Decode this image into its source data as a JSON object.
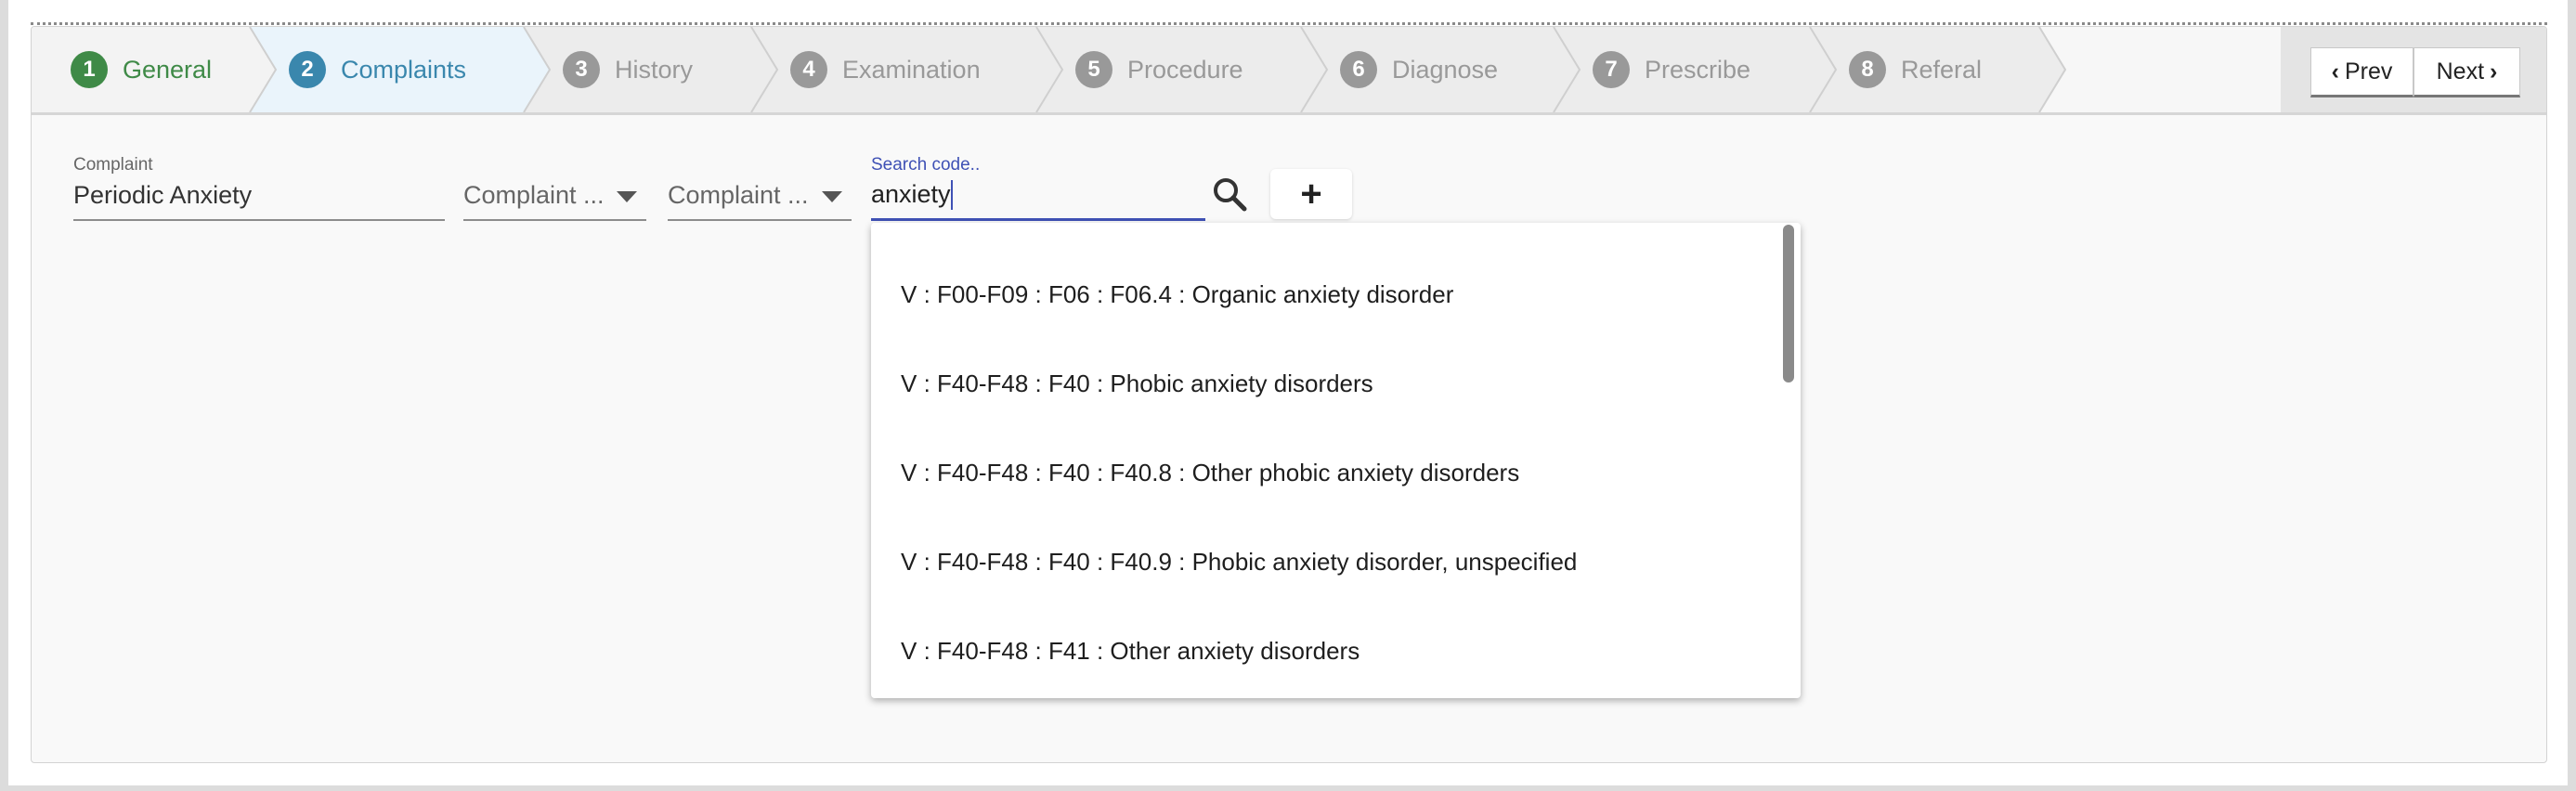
{
  "wizard": {
    "steps": [
      {
        "number": "1",
        "label": "General",
        "state": "completed"
      },
      {
        "number": "2",
        "label": "Complaints",
        "state": "active"
      },
      {
        "number": "3",
        "label": "History",
        "state": "pending"
      },
      {
        "number": "4",
        "label": "Examination",
        "state": "pending"
      },
      {
        "number": "5",
        "label": "Procedure",
        "state": "pending"
      },
      {
        "number": "6",
        "label": "Diagnose",
        "state": "pending"
      },
      {
        "number": "7",
        "label": "Prescribe",
        "state": "pending"
      },
      {
        "number": "8",
        "label": "Referal",
        "state": "pending"
      }
    ],
    "prev_label": "Prev",
    "next_label": "Next"
  },
  "form": {
    "complaint_label": "Complaint",
    "complaint_value": "Periodic Anxiety",
    "select1_value": "Complaint ...",
    "select2_value": "Complaint ...",
    "search_label": "Search code..",
    "search_value": "anxiety",
    "add_label": "+"
  },
  "results": [
    "V : F00-F09 : F06 : F06.4 : Organic anxiety disorder",
    "V : F40-F48 : F40 : Phobic anxiety disorders",
    "V : F40-F48 : F40 : F40.8 : Other phobic anxiety disorders",
    "V : F40-F48 : F40 : F40.9 : Phobic anxiety disorder, unspecified",
    "V : F40-F48 : F41 : Other anxiety disorders"
  ],
  "colors": {
    "completed": "#3f8a47",
    "active": "#3a87ad",
    "pending": "#999999",
    "focus": "#3f51b5"
  }
}
